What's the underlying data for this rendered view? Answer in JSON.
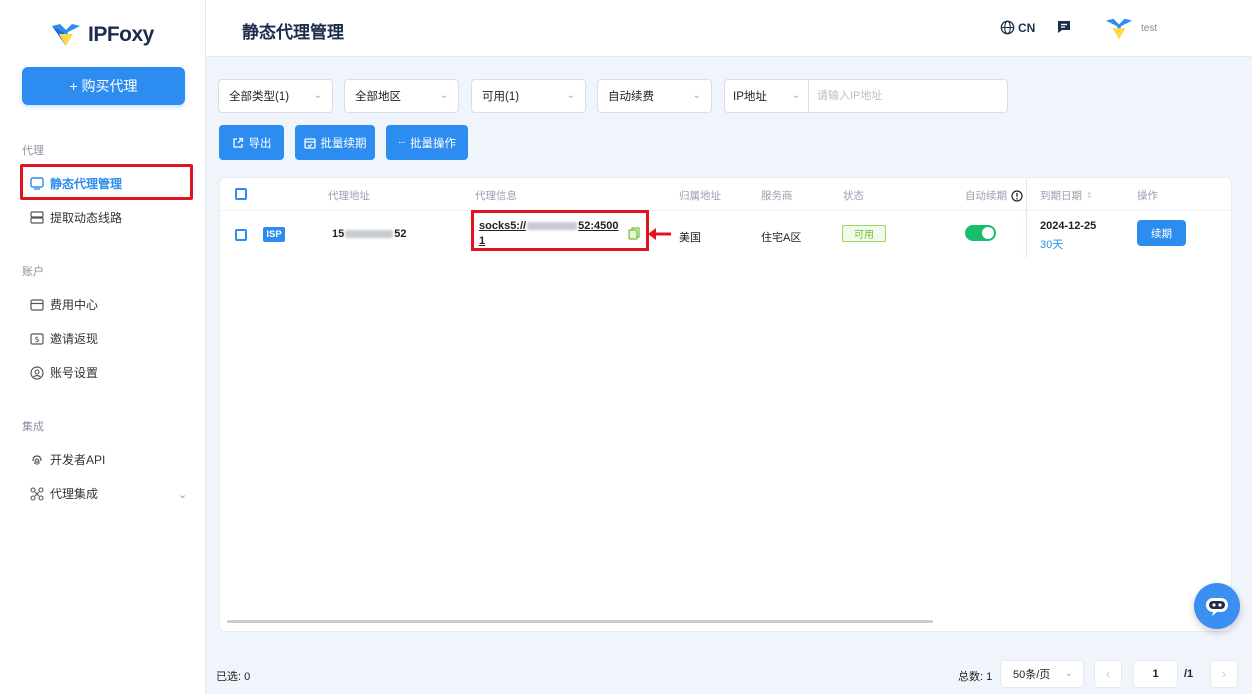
{
  "app": {
    "name": "IPFoxy"
  },
  "sidebar": {
    "buy_button": "+ 购买代理",
    "groups": [
      "代理",
      "账户",
      "集成"
    ],
    "items": [
      {
        "label": "静态代理管理",
        "icon": "monitor-icon",
        "active": true
      },
      {
        "label": "提取动态线路",
        "icon": "server-icon"
      },
      {
        "label": "费用中心",
        "icon": "card-icon"
      },
      {
        "label": "邀请返现",
        "icon": "dollar-icon"
      },
      {
        "label": "账号设置",
        "icon": "user-circle-icon"
      },
      {
        "label": "开发者API",
        "icon": "fingerprint-icon"
      },
      {
        "label": "代理集成",
        "icon": "integration-icon"
      }
    ]
  },
  "header": {
    "title": "静态代理管理",
    "lang": "CN",
    "user": "test"
  },
  "filters": {
    "type": "全部类型(1)",
    "region": "全部地区",
    "status": "可用(1)",
    "auto_renew": "自动续费",
    "ip_field": "IP地址",
    "ip_placeholder": "请输入IP地址"
  },
  "actions": {
    "export": "导出",
    "batch_renew": "批量续期",
    "batch_ops": "批量操作"
  },
  "table": {
    "columns": [
      "代理地址",
      "代理信息",
      "归属地址",
      "服务商",
      "状态",
      "自动续期",
      "到期日期",
      "操作"
    ],
    "rows": [
      {
        "badge": "ISP",
        "address_prefix": "15",
        "address_suffix": "52",
        "proxy_prefix": "socks5://",
        "proxy_suffix": "52:45001",
        "location": "美国",
        "provider": "住宅A区",
        "status": "可用",
        "auto_renew": true,
        "expire_date": "2024-12-25",
        "days_left": "30天",
        "action": "续期"
      }
    ]
  },
  "footer": {
    "selected": "已选: 0",
    "total": "总数: 1",
    "page_size": "50条/页",
    "page": "1",
    "page_total": "/1"
  }
}
